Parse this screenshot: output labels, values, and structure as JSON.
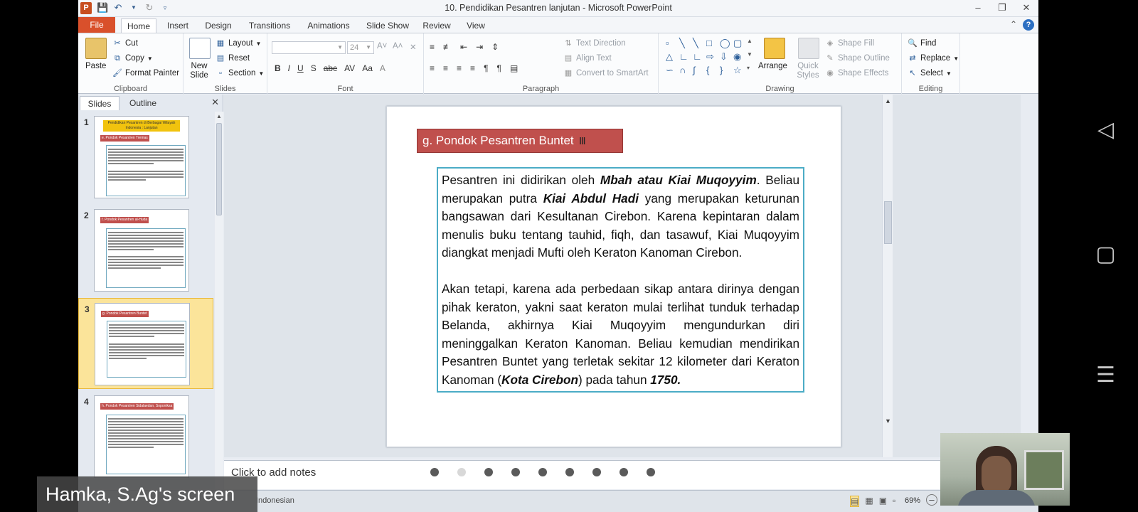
{
  "window": {
    "title": "10. Pendidikan Pesantren lanjutan - Microsoft PowerPoint",
    "app_icon": "P",
    "qat": [
      "save-icon",
      "undo-icon",
      "redo-icon"
    ],
    "controls": [
      "minimize-icon",
      "restore-icon",
      "close-icon"
    ]
  },
  "tabs": {
    "file": "File",
    "items": [
      "Home",
      "Insert",
      "Design",
      "Transitions",
      "Animations",
      "Slide Show",
      "Review",
      "View"
    ],
    "active": "Home"
  },
  "ribbon": {
    "clipboard": {
      "label": "Clipboard",
      "paste": "Paste",
      "cut": "Cut",
      "copy": "Copy",
      "format_painter": "Format Painter"
    },
    "slides": {
      "label": "Slides",
      "new_slide": "New Slide",
      "layout": "Layout",
      "reset": "Reset",
      "section": "Section"
    },
    "font": {
      "label": "Font",
      "font_name": "",
      "font_size": "24"
    },
    "paragraph": {
      "label": "Paragraph",
      "text_direction": "Text Direction",
      "align_text": "Align Text",
      "smartart": "Convert to SmartArt"
    },
    "drawing": {
      "label": "Drawing",
      "arrange": "Arrange",
      "quick_styles": "Quick Styles",
      "shape_fill": "Shape Fill",
      "shape_outline": "Shape Outline",
      "shape_effects": "Shape Effects"
    },
    "editing": {
      "label": "Editing",
      "find": "Find",
      "replace": "Replace",
      "select": "Select"
    }
  },
  "left_pane": {
    "tabs": [
      "Slides",
      "Outline"
    ],
    "active_tab": "Slides",
    "thumbnails": [
      {
        "num": "1",
        "title": "Pendidikan Pesantren di Berbagai Wilayah Indonesia : Lanjutan",
        "subtitle": "e. Pondok Pesantren Tremas"
      },
      {
        "num": "2",
        "title": "f. Pondok Pesantren al-Huda"
      },
      {
        "num": "3",
        "title": "g. Pondok Pesantren Buntet"
      },
      {
        "num": "4",
        "title": "h. Pondok Pesantren Sidalaedan, Soponiksa"
      }
    ],
    "selected": 3
  },
  "slide": {
    "title": "g. Pondok Pesantren Buntet",
    "paragraphs": [
      [
        {
          "t": "Pesantren ini didirikan oleh "
        },
        {
          "t": "Mbah atau Kiai Muqoyyim",
          "b": true
        },
        {
          "t": ". Beliau merupakan putra "
        },
        {
          "t": "Kiai Abdul Hadi",
          "b": true
        },
        {
          "t": " yang merupakan keturunan bangsawan dari Kesultanan Cirebon. Karena kepintaran dalam menulis buku tentang tauhid, fiqh, dan tasawuf, Kiai Muqoyyim diangkat menjadi Mufti oleh Keraton Kanoman Cirebon."
        }
      ],
      [
        {
          "t": "Akan tetapi, karena ada perbedaan sikap antara dirinya dengan pihak keraton, yakni saat keraton mulai terlihat tunduk terhadap Belanda, akhirnya Kiai Muqoyyim mengundurkan diri meninggalkan Keraton Kanoman. Beliau kemudian mendirikan Pesantren Buntet yang terletak sekitar 12 kilometer dari Keraton Kanoman ("
        },
        {
          "t": "Kota Cirebon",
          "b": true
        },
        {
          "t": ") pada tahun "
        },
        {
          "t": "1750.",
          "b": true
        }
      ]
    ]
  },
  "notes": {
    "placeholder": "Click to add notes"
  },
  "dots": {
    "count": 9,
    "active_index": 1
  },
  "status": {
    "language": "Indonesian",
    "zoom": "69%"
  },
  "overlay": {
    "share_label": "Hamka, S.Ag's screen"
  }
}
